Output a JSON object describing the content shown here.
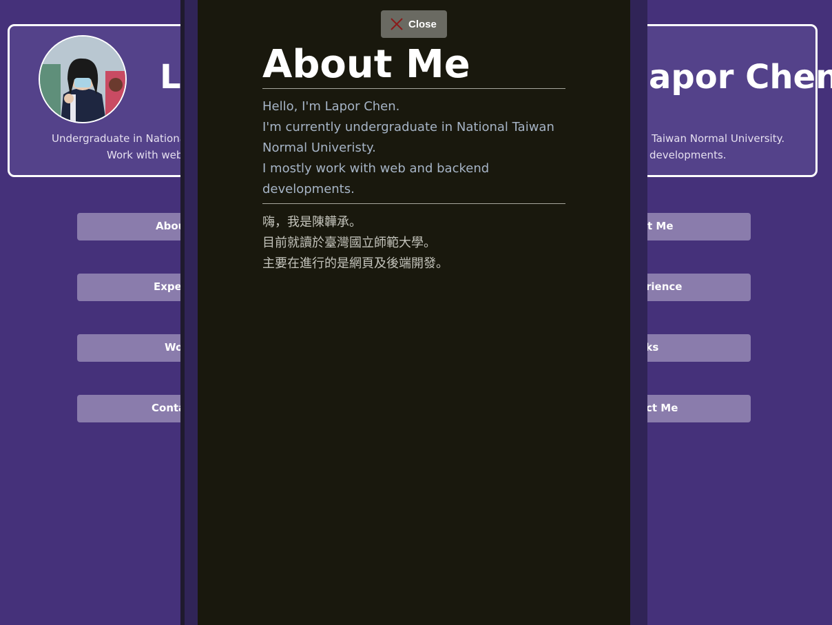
{
  "profile": {
    "name_left_visible": "La",
    "name_right_visible": "apor Chen",
    "line1_left": "Undergraduate in National",
    "line1_right": "Taiwan Normal University.",
    "line2_left": "Work with web",
    "line2_right": "developments."
  },
  "nav": {
    "items": [
      {
        "left": "Abou",
        "right": "t Me"
      },
      {
        "left": "Exper",
        "right": "rience"
      },
      {
        "left": "Wo",
        "right": "rks"
      },
      {
        "left": "Conta",
        "right": "ct Me"
      }
    ]
  },
  "modal": {
    "close_label": "Close",
    "close_icon": "close-x-icon",
    "title": "About Me",
    "english_lines": [
      "Hello, I'm Lapor Chen.",
      "I'm currently undergraduate in National Taiwan",
      "Normal Univeristy.",
      "I mostly work with web and backend",
      "developments."
    ],
    "chinese_lines": [
      "嗨，我是陳韡承。",
      "目前就讀於臺灣國立師範大學。",
      "主要在進行的是網頁及後端開發。"
    ]
  },
  "colors": {
    "page_background": "#45317a",
    "card_background": "#54428a",
    "nav_button": "#8a7cac",
    "modal_background": "#19180d",
    "close_button": "#6a6a62",
    "close_icon": "#8b1a1a",
    "english_text": "#a6b4c6",
    "chinese_text": "#c4c4bc"
  }
}
